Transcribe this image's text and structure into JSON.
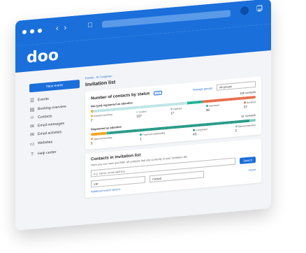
{
  "app": {
    "brand": "doo"
  },
  "sidebar": {
    "new_event": "New event",
    "items": [
      {
        "label": "Events",
        "icon": "list-icon"
      },
      {
        "label": "Booking overview",
        "icon": "document-icon"
      },
      {
        "label": "Contacts",
        "icon": "person-icon"
      },
      {
        "label": "Email messages",
        "icon": "envelope-icon"
      },
      {
        "label": "Email activities",
        "icon": "envelope-check-icon"
      },
      {
        "label": "Websites",
        "icon": "monitor-icon"
      }
    ],
    "help": "Help center"
  },
  "main": {
    "breadcrumb": "Events · AI Congress ·",
    "title": "Invitation list",
    "manage_groups": "Manage groups",
    "group_select": "All groups",
    "contacts_status": {
      "title": "Number of contacts by status",
      "badge": "241",
      "not_registered": {
        "label": "Not (yet) registered as attendee",
        "total": "186 contacts",
        "colors": [
          "#f5a623",
          "#bfe6e6",
          "#1fb59a",
          "#e9704e"
        ],
        "shares": [
          0.011,
          0.575,
          0.091,
          0.323
        ],
        "stats": [
          {
            "label": "Invitation pending",
            "value": "2",
            "color": "#f5a623"
          },
          {
            "label": "Invited",
            "value": "107",
            "color": "#bfe6e6"
          },
          {
            "label": "Opened",
            "value": "17",
            "color": "#9fc9e8"
          },
          {
            "label": "Interested",
            "value": "38",
            "color": "#1fb59a"
          },
          {
            "label": "Declined",
            "value": "22",
            "color": "#e9704e"
          }
        ]
      },
      "registered": {
        "label": "Registered as attendee",
        "total": "51 contacts",
        "colors": [
          "#f5a623",
          "#1fb59a",
          "#2b9c8a",
          "#7fd0c0"
        ],
        "shares": [
          0.098,
          0.02,
          0.843,
          0.039
        ],
        "stats": [
          {
            "label": "Approval pending",
            "value": "5",
            "color": "#f5a623"
          },
          {
            "label": "Payment outstanding",
            "value": "1",
            "color": "#1fb59a"
          },
          {
            "label": "Completed",
            "value": "43",
            "color": "#2b9c8a"
          },
          {
            "label": "Special Attendee",
            "value": "2",
            "color": "#7fd0c0"
          }
        ]
      }
    },
    "contacts_list": {
      "title": "Contacts in invitation list",
      "description": "Here you can view and filter all contacts that are currently in your invitation list.",
      "search_placeholder": "e.g. name, email address",
      "search_button": "Search",
      "reset": "Reset",
      "filter1": "VIP",
      "filter2": "Clicked",
      "advanced": "Additional search options"
    }
  }
}
